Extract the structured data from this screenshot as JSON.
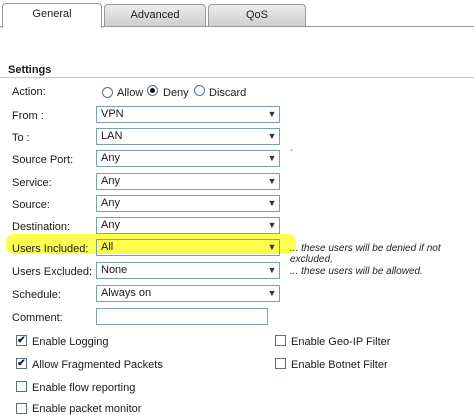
{
  "tabs": [
    {
      "label": "General"
    },
    {
      "label": "Advanced"
    },
    {
      "label": "QoS"
    }
  ],
  "settings": {
    "title": "Settings",
    "action": {
      "label": "Action:",
      "options": [
        "Allow",
        "Deny",
        "Discard"
      ],
      "selected": "Deny"
    },
    "from": {
      "label": "From :",
      "value": "VPN"
    },
    "to": {
      "label": "To :",
      "value": "LAN"
    },
    "source_port": {
      "label": "Source Port:",
      "value": "Any"
    },
    "service": {
      "label": "Service:",
      "value": "Any"
    },
    "source": {
      "label": "Source:",
      "value": "Any"
    },
    "destination": {
      "label": "Destination:",
      "value": "Any"
    },
    "users_included": {
      "label": "Users Included:",
      "value": "All",
      "note": "... these users will be denied if not excluded,"
    },
    "users_excluded": {
      "label": "Users Excluded:",
      "value": "None",
      "note": "... these users will be allowed."
    },
    "schedule": {
      "label": "Schedule:",
      "value": "Always on"
    },
    "comment": {
      "label": "Comment:",
      "value": ""
    },
    "checkboxes": {
      "enable_logging": {
        "label": "Enable Logging",
        "checked": true
      },
      "allow_fragmented": {
        "label": "Allow Fragmented Packets",
        "checked": true
      },
      "flow_reporting": {
        "label": "Enable flow reporting",
        "checked": false
      },
      "packet_monitor": {
        "label": "Enable packet monitor",
        "checked": false
      },
      "geo_ip": {
        "label": "Enable Geo-IP Filter",
        "checked": false
      },
      "botnet": {
        "label": "Enable Botnet Filter",
        "checked": false
      }
    }
  },
  "icons": {
    "dropdown_arrow": "chevron-down-icon",
    "check_mark": "✔"
  },
  "highlight_color": "#fbff2e"
}
